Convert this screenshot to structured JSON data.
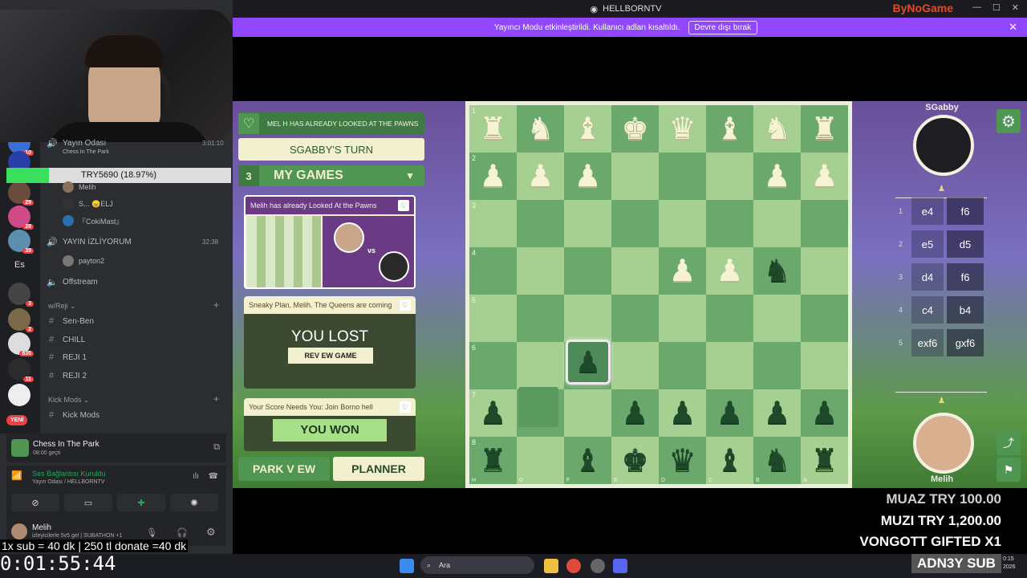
{
  "window": {
    "title": "HELLBORNTV",
    "brand": "ByNoGame"
  },
  "banner": {
    "text": "Yayıncı Modu etkinleştirildi. Kullanıcı adları kısaltıldı.",
    "button": "Devre dışı bırak"
  },
  "discord": {
    "voice_channel_top": {
      "name": "Yayın Odası",
      "activity": "Chess In The Park",
      "time": "3:01:10"
    },
    "progress": {
      "label": "TRY5690 (18.97%)",
      "percent": 18.97
    },
    "members": [
      {
        "name": "Melih"
      },
      {
        "name": "S... 😠ELJ"
      },
      {
        "name": "『CokiMast』"
      }
    ],
    "channels": [
      {
        "name": "YAYIN İZLİYORUM",
        "time": "32:38"
      },
      {
        "name": "payton2"
      },
      {
        "name": "Offstream"
      }
    ],
    "category1": "w/Reji",
    "text_channels": [
      "Sen-Ben",
      "CHILL",
      "REJI 1",
      "REJI 2"
    ],
    "category2": "Kick Mods",
    "kick_channel": "Kick Mods",
    "server_es": "Es",
    "new_badge": "YENİ",
    "badges": [
      "10",
      "29",
      "28",
      "39",
      "3",
      "2",
      "835",
      "11"
    ],
    "activity_card": {
      "title": "Chess In The Park",
      "sub": "08:00 geçti"
    },
    "voice_status": {
      "title": "Ses Bağlantısı Kuruldu",
      "sub": "Yayın Odası / HELLBORNTV"
    },
    "user": {
      "name": "Melih",
      "status": "izleyicilerle 5v5 gel | SUBATHON +1"
    }
  },
  "game": {
    "notification": "MEL H HAS ALREADY LOOKED AT THE PAWNS",
    "turn": "SGABBY'S TURN",
    "games_count": "3",
    "games_title": "MY GAMES",
    "cards": [
      {
        "title": "Melih has already Looked At the Pawns",
        "vs": "vs"
      },
      {
        "title": "Sneaky Plan, Melih. The Queens are coming",
        "result": "YOU LOST",
        "button": "REV EW GAME"
      },
      {
        "title": "Your Score Needs You: Join Borno hell",
        "result": "YOU WON"
      }
    ],
    "btn_park": "PARK V EW",
    "btn_planner": "PLANNER",
    "opponent": "SGabby",
    "player": "Melih",
    "ranks": [
      "1",
      "2",
      "3",
      "4",
      "5",
      "6",
      "7",
      "8"
    ],
    "files": [
      "H",
      "G",
      "F",
      "E",
      "D",
      "C",
      "B",
      "A"
    ],
    "moves": [
      {
        "n": "1",
        "w": "e4",
        "b": "f6"
      },
      {
        "n": "2",
        "w": "e5",
        "b": "d5"
      },
      {
        "n": "3",
        "w": "d4",
        "b": "f6"
      },
      {
        "n": "4",
        "w": "c4",
        "b": "b4"
      },
      {
        "n": "5",
        "w": "exf6",
        "b": "gxf6"
      }
    ],
    "board": [
      [
        "wR",
        "wN",
        "wB",
        "wK",
        "wQ",
        "wB",
        "wN",
        "wR"
      ],
      [
        "wP",
        "wP",
        "wP",
        "",
        "",
        "",
        "wP",
        "wP"
      ],
      [
        "",
        "",
        "",
        "",
        "",
        "",
        "",
        ""
      ],
      [
        "",
        "",
        "",
        "",
        "wP",
        "wP",
        "bN",
        ""
      ],
      [
        "",
        "",
        "",
        "",
        "",
        "",
        "",
        ""
      ],
      [
        "",
        "",
        "bP",
        "",
        "",
        "",
        "",
        ""
      ],
      [
        "bP",
        "",
        "",
        "bP",
        "bP",
        "bP",
        "bP",
        "bP"
      ],
      [
        "bR",
        "",
        "bB",
        "bK",
        "bQ",
        "bB",
        "bN",
        "bR"
      ]
    ]
  },
  "donations": [
    {
      "text": "MUAZ  TRY 100.00",
      "color": "#d8d8d8"
    },
    {
      "text": "MUZI  TRY 1,200.00",
      "color": "#ffffff"
    },
    {
      "text": "VONGOTT  GIFTED X1",
      "color": "#ffffff"
    }
  ],
  "overlay": {
    "subline": "1x sub = 40 dk | 250 tl donate =40 dk",
    "timer": "0:01:55:44",
    "adn": "ADN3Y  SUB"
  },
  "taskbar": {
    "search": "Ara",
    "clock_time": "0:15",
    "clock_year": "2026"
  }
}
